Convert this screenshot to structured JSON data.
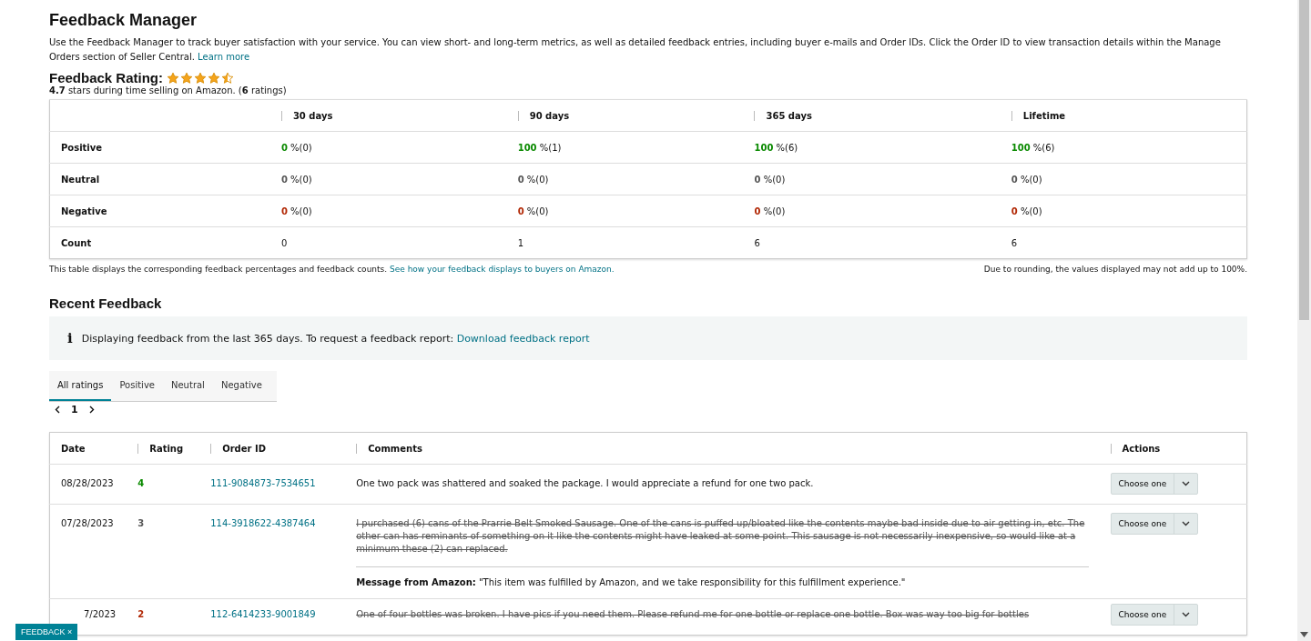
{
  "title": "Feedback Manager",
  "intro": "Use the Feedback Manager to track buyer satisfaction with your service. You can view short- and long-term metrics, as well as detailed feedback entries, including buyer e-mails and Order IDs. Click the Order ID to view transaction details within the Manage Orders section of Seller Central.",
  "intro_link": "Learn more",
  "rating": {
    "label": "Feedback Rating:",
    "stars": 4.5,
    "summary": "**4.7** stars during time selling on Amazon. (**6** ratings)"
  },
  "metrics": {
    "columns": [
      "30 days",
      "90 days",
      "365 days",
      "Lifetime"
    ],
    "rows": [
      {
        "label": "Positive",
        "kind": "positive",
        "cells": [
          {
            "value": "0",
            "rest": "%(0)"
          },
          {
            "value": "100",
            "rest": "%(1)"
          },
          {
            "value": "100",
            "rest": "%(6)"
          },
          {
            "value": "100",
            "rest": "%(6)"
          }
        ]
      },
      {
        "label": "Neutral",
        "kind": "neutral",
        "cells": [
          {
            "value": "0",
            "rest": "%(0)"
          },
          {
            "value": "0",
            "rest": "%(0)"
          },
          {
            "value": "0",
            "rest": "%(0)"
          },
          {
            "value": "0",
            "rest": "%(0)"
          }
        ]
      },
      {
        "label": "Negative",
        "kind": "negative",
        "cells": [
          {
            "value": "0",
            "rest": "%(0)"
          },
          {
            "value": "0",
            "rest": "%(0)"
          },
          {
            "value": "0",
            "rest": "%(0)"
          },
          {
            "value": "0",
            "rest": "%(0)"
          }
        ]
      },
      {
        "label": "Count",
        "kind": "count",
        "cells": [
          {
            "value": "0"
          },
          {
            "value": "1"
          },
          {
            "value": "6"
          },
          {
            "value": "6"
          }
        ]
      }
    ],
    "note": "This table displays the corresponding feedback percentages and feedback counts.",
    "note_link": "See how your feedback displays to buyers on Amazon.",
    "rounding_note": "Due to rounding, the values displayed may not add up to 100%."
  },
  "recent": {
    "title": "Recent Feedback",
    "info_icon": "i",
    "info": "Displaying feedback from the last 365 days. To request a feedback report:",
    "info_link": "Download feedback report",
    "tabs": [
      {
        "label": "All ratings",
        "selected": true
      },
      {
        "label": "Positive",
        "selected": false
      },
      {
        "label": "Neutral",
        "selected": false
      },
      {
        "label": "Negative",
        "selected": false
      }
    ],
    "page": "1"
  },
  "feedback": {
    "columns": [
      "Date",
      "Rating",
      "Order ID",
      "Comments",
      "Actions"
    ],
    "rows": [
      {
        "date": "08/28/2023",
        "rating": "4",
        "kind": "positive",
        "order_id": "111-9084873-7534651",
        "comment": "One two pack was shattered and soaked the package. I would appreciate a refund for one two pack.",
        "struck": false,
        "action": "Choose one"
      },
      {
        "date": "07/28/2023",
        "rating": "3",
        "kind": "neutral",
        "order_id": "114-3918622-4387464",
        "comment": "I purchased (6) cans of the Prarrie Belt Smoked Sausage. One of the cans is puffed up/bloated like the contents maybe bad inside due to air getting in, etc. The other can has reminants of something on it like the contents might have leaked at some point. This sausage is not necessarily inexpensive, so would like at a minimum these (2) can replaced.",
        "struck": true,
        "message": "**Message from Amazon:** \"This item was fulfilled by Amazon, and we take responsibility for this fulfillment experience.\"",
        "action": "Choose one"
      },
      {
        "date": "7/2023",
        "rating": "2",
        "kind": "negative",
        "order_id": "112-6414233-9001849",
        "comment": "One of four bottles was broken. I have pics if you need them. Please refund me for one bottle or replace one bottle. Box was way too big for bottles",
        "struck": true,
        "action": "Choose one"
      }
    ]
  },
  "feedback_tab": {
    "label": "FEEDBACK",
    "close": "×"
  }
}
